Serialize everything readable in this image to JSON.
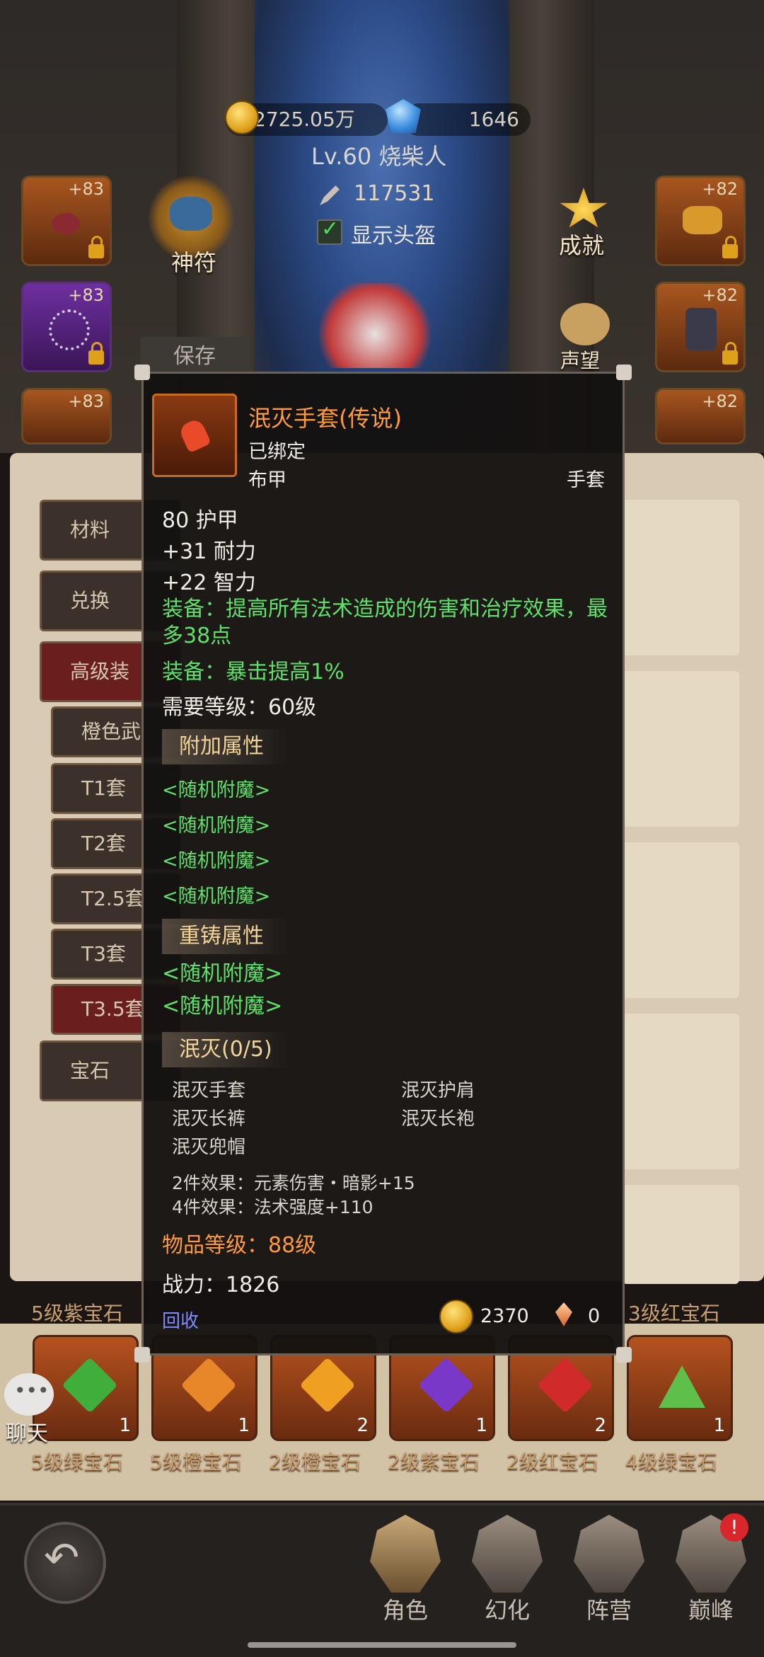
{
  "header": {
    "gold": "2725.05万",
    "diamonds": "1646",
    "player": "Lv.60 烧柴人",
    "power": "117531",
    "show_helmet": "显示头盔",
    "rune_label": "神符",
    "achievement_label": "成就",
    "reputation_label": "声望",
    "save_label": "保存"
  },
  "equip_slots": {
    "left": [
      "+83",
      "+83",
      "+83"
    ],
    "right": [
      "+82",
      "+82",
      "+82"
    ]
  },
  "left_menu": [
    "材料",
    "兑换",
    "高级装",
    "橙色武",
    "T1套",
    "T2套",
    "T2.5套",
    "T3套",
    "T3.5套",
    "宝石"
  ],
  "tooltip": {
    "name": "泯灭手套(传说)",
    "bound": "已绑定",
    "armor_type": "布甲",
    "slot": "手套",
    "stats": [
      "80 护甲",
      "+31 耐力",
      "+22 智力"
    ],
    "equip_effects": [
      "装备：提高所有法术造成的伤害和治疗效果，最多38点",
      "装备：暴击提高1%"
    ],
    "required_level": "需要等级：60级",
    "extra_header": "附加属性",
    "extra": [
      "<随机附魔>",
      "<随机附魔>",
      "<随机附魔>",
      "<随机附魔>"
    ],
    "reforge_header": "重铸属性",
    "reforge": [
      "<随机附魔>",
      "<随机附魔>"
    ],
    "set_header": "泯灭(0/5)",
    "set_items": [
      "泯灭手套",
      "泯灭护肩",
      "泯灭长裤",
      "泯灭长袍",
      "泯灭兜帽"
    ],
    "set_bonus": [
      "2件效果：元素伤害・暗影+15",
      "4件效果：法术强度+110"
    ],
    "item_level": "物品等级：88级",
    "combat_power": "战力：1826",
    "recycle": "回收",
    "price_gold": "2370",
    "price_shard": "0"
  },
  "gem_labels_top": [
    "5级紫宝石",
    "3级红宝石"
  ],
  "gems": [
    {
      "count": "1",
      "label": "5级绿宝石",
      "color": "#3fae3a"
    },
    {
      "count": "1",
      "label": "5级橙宝石",
      "color": "#e8862a"
    },
    {
      "count": "2",
      "label": "2级橙宝石",
      "color": "#f0a020"
    },
    {
      "count": "1",
      "label": "2级紫宝石",
      "color": "#7a38c8"
    },
    {
      "count": "2",
      "label": "2级红宝石",
      "color": "#d12a2a"
    },
    {
      "count": "1",
      "label": "4级绿宝石",
      "color": "#5ec04a"
    }
  ],
  "chat_label": "聊天",
  "nav": [
    "角色",
    "幻化",
    "阵营",
    "巅峰"
  ]
}
